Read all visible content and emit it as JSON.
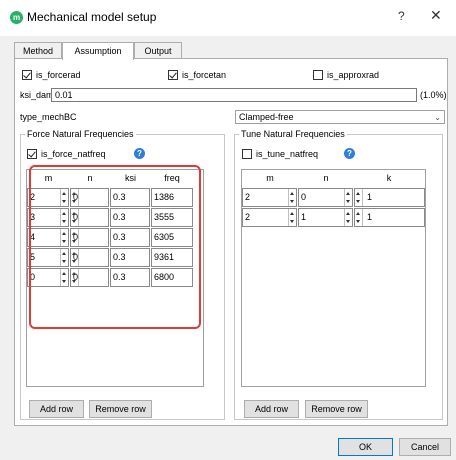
{
  "window": {
    "title": "Mechanical model setup",
    "app_icon_letter": "m",
    "help_glyph": "?",
    "close_glyph": "✕"
  },
  "tabs": [
    {
      "label": "Method",
      "active": false
    },
    {
      "label": "Assumption",
      "active": true
    },
    {
      "label": "Output",
      "active": false
    }
  ],
  "assumption": {
    "is_forcerad": {
      "label": "is_forcerad",
      "checked": true
    },
    "is_forcetan": {
      "label": "is_forcetan",
      "checked": true
    },
    "is_approxrad": {
      "label": "is_approxrad",
      "checked": false
    },
    "ksi_damp": {
      "label": "ksi_damp",
      "value": "0.01",
      "suffix": "(1.0%)"
    },
    "type_mechBC": {
      "label": "type_mechBC",
      "value": "Clamped-free"
    }
  },
  "force_group": {
    "title": "Force Natural Frequencies",
    "checkbox": {
      "label": "is_force_natfreq",
      "checked": true
    },
    "help_icon": "help-icon",
    "columns": [
      "m",
      "n",
      "ksi",
      "freq"
    ],
    "rows": [
      {
        "m": "2",
        "n": "0",
        "ksi": "0.3",
        "freq": "1386"
      },
      {
        "m": "3",
        "n": "0",
        "ksi": "0.3",
        "freq": "3555"
      },
      {
        "m": "4",
        "n": "0",
        "ksi": "0.3",
        "freq": "6305"
      },
      {
        "m": "5",
        "n": "0",
        "ksi": "0.3",
        "freq": "9361"
      },
      {
        "m": "0",
        "n": "0",
        "ksi": "0.3",
        "freq": "6800"
      }
    ],
    "add_row": "Add row",
    "remove_row": "Remove row"
  },
  "tune_group": {
    "title": "Tune Natural Frequencies",
    "checkbox": {
      "label": "is_tune_natfreq",
      "checked": false
    },
    "help_icon": "help-icon",
    "columns": [
      "m",
      "n",
      "k"
    ],
    "rows": [
      {
        "m": "2",
        "n": "0",
        "k": "1"
      },
      {
        "m": "2",
        "n": "1",
        "k": "1"
      }
    ],
    "add_row": "Add row",
    "remove_row": "Remove row"
  },
  "footer": {
    "ok": "OK",
    "cancel": "Cancel"
  },
  "colors": {
    "highlight": "#e53935",
    "accent": "#0078d7",
    "app_icon": "#28b06a",
    "help_icon": "#2f7fd8"
  }
}
